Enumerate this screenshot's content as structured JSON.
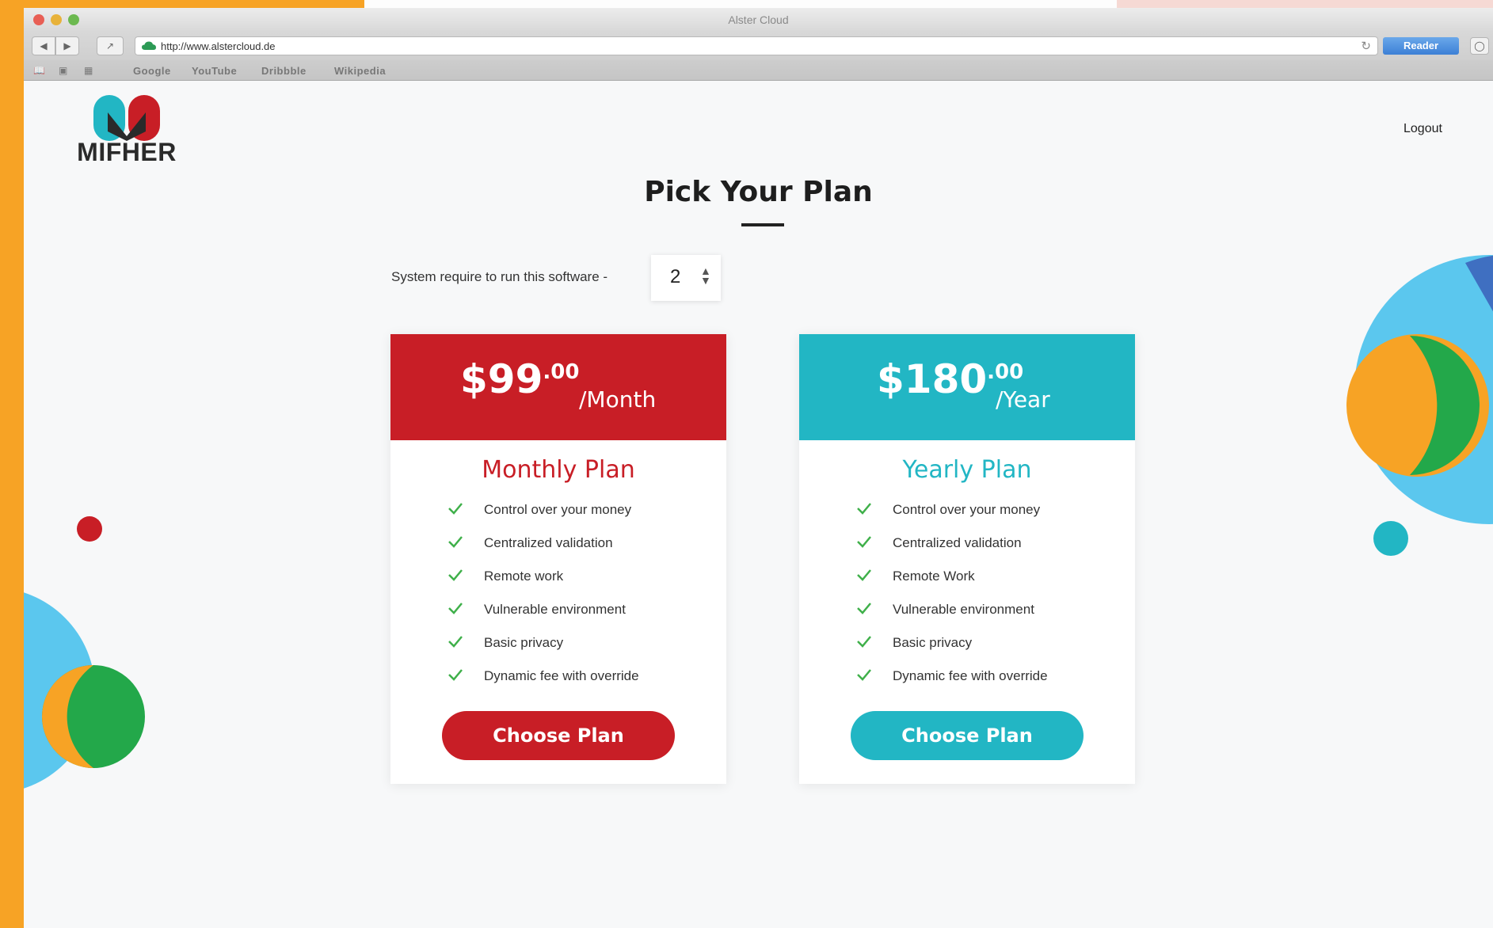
{
  "browser": {
    "window_title": "Alster Cloud",
    "url": "http://www.alstercloud.de",
    "reader_label": "Reader",
    "bookmarks": [
      "Google",
      "YouTube",
      "Dribbble",
      "Wikipedia"
    ]
  },
  "header": {
    "logo_text": "MIFHER",
    "logout_label": "Logout"
  },
  "main": {
    "title": "Pick Your Plan",
    "system_label": "System require to run this software -",
    "system_count": "2"
  },
  "plans": [
    {
      "price": "$99",
      "cents": ".00",
      "period": "/Month",
      "name": "Monthly Plan",
      "features": [
        "Control over your money",
        "Centralized validation",
        "Remote work",
        "Vulnerable environment",
        "Basic privacy",
        "Dynamic fee with override"
      ],
      "button_label": "Choose Plan"
    },
    {
      "price": "$180",
      "cents": ".00",
      "period": "/Year",
      "name": "Yearly Plan",
      "features": [
        "Control over your money",
        "Centralized validation",
        "Remote Work",
        "Vulnerable environment",
        "Basic privacy",
        "Dynamic fee with override"
      ],
      "button_label": "Choose Plan"
    }
  ],
  "colors": {
    "monthly_accent": "#c81e26",
    "yearly_accent": "#22b6c4",
    "check_green": "#3fb04a",
    "frame_orange": "#f7a325"
  },
  "icons": {
    "check": "check-icon",
    "cloud": "cloud-icon",
    "reload": "reload-icon",
    "stepper": "stepper-arrows-icon"
  }
}
